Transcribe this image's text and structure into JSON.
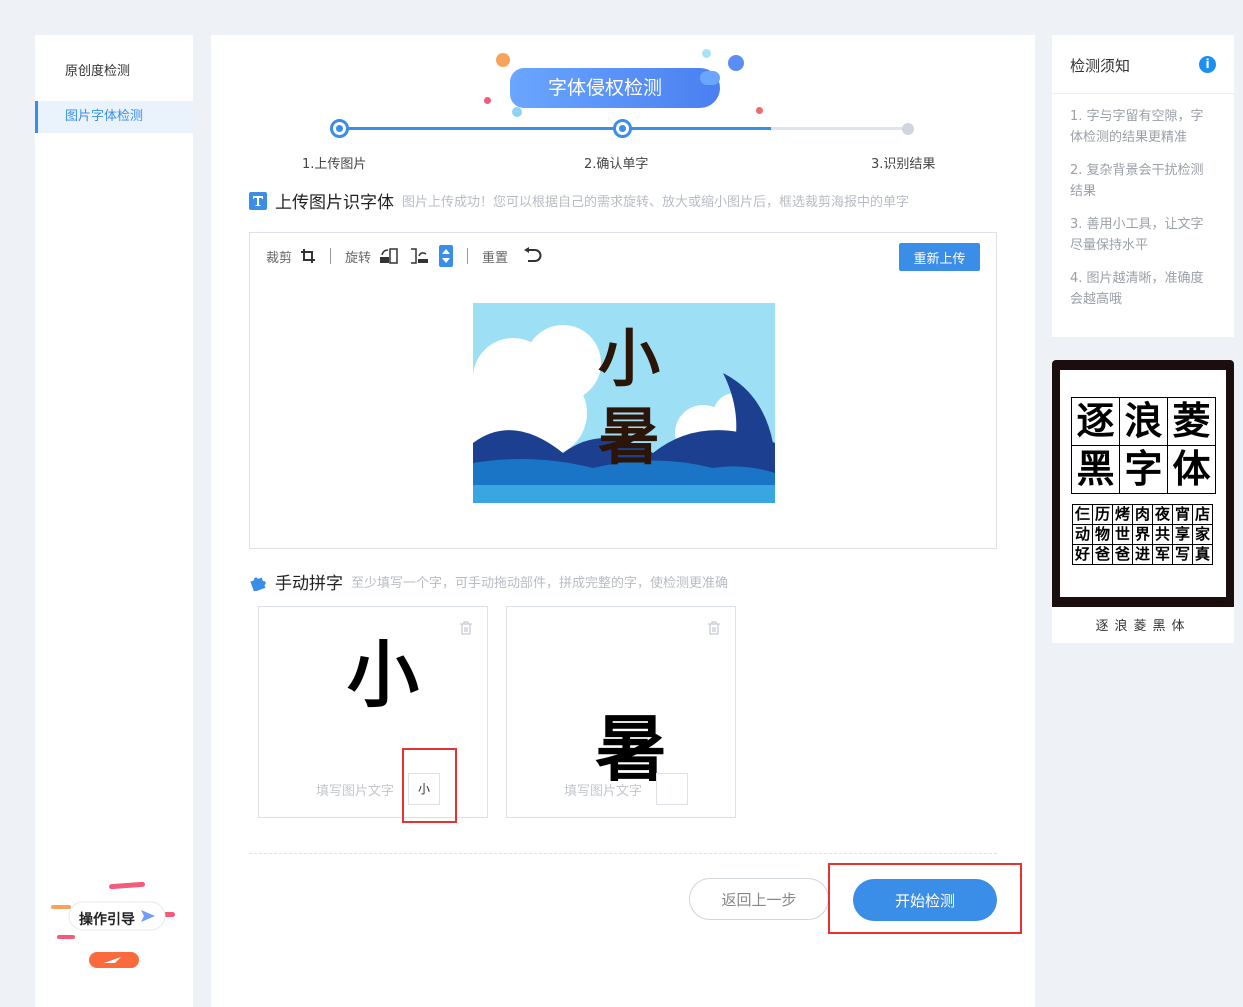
{
  "sidebar": {
    "items": [
      {
        "label": "原创度检测"
      },
      {
        "label": "图片字体检测"
      }
    ],
    "guide_label": "操作引导"
  },
  "banner": {
    "title": "字体侵权检测"
  },
  "steps": [
    {
      "label": "1.上传图片"
    },
    {
      "label": "2.确认单字"
    },
    {
      "label": "3.识别结果"
    }
  ],
  "upload": {
    "title": "上传图片识字体",
    "subtitle": "图片上传成功！您可以根据自己的需求旋转、放大或缩小图片后，框选裁剪海报中的单字",
    "toolbar": {
      "crop_label": "裁剪",
      "rotate_label": "旋转",
      "reset_label": "重置"
    },
    "reupload_label": "重新上传",
    "poster_chars": [
      "小",
      "暑"
    ]
  },
  "manual": {
    "title": "手动拼字",
    "subtitle": "至少填写一个字，可手动拖动部件，拼成完整的字，使检测更准确",
    "cards": [
      {
        "glyph": "小",
        "fill_label": "填写图片文字",
        "value": "小"
      },
      {
        "glyph": "暑",
        "fill_label": "填写图片文字",
        "value": ""
      }
    ]
  },
  "buttons": {
    "back_label": "返回上一步",
    "start_label": "开始检测"
  },
  "notes": {
    "title": "检测须知",
    "items": [
      "1. 字与字留有空隙，字体检测的结果更精准",
      "2. 复杂背景会干扰检测结果",
      "3. 善用小工具，让文字尽量保持水平",
      "4. 图片越清晰，准确度会越高哦"
    ]
  },
  "font_card": {
    "name": "逐浪菱黑体",
    "big_chars": [
      "逐",
      "浪",
      "菱",
      "黑",
      "字",
      "体"
    ],
    "small_chars": [
      "仨",
      "历",
      "烤",
      "肉",
      "夜",
      "宵",
      "店",
      "动",
      "物",
      "世",
      "界",
      "共",
      "享",
      "家",
      "好",
      "爸",
      "爸",
      "进",
      "军",
      "写",
      "真"
    ]
  },
  "colors": {
    "accent": "#3b8ee8",
    "highlight": "#e53333"
  }
}
